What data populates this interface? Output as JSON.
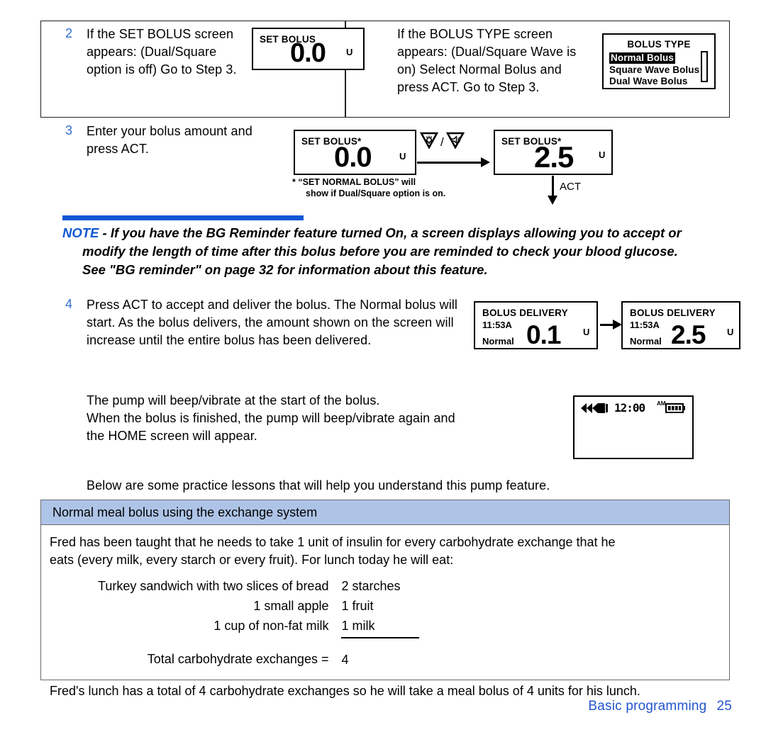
{
  "document": {
    "title": "Insulin pump user guide - Basic programming",
    "footer": {
      "section": "Basic programming",
      "page": "25"
    }
  },
  "colors": {
    "accent_blue": "#0f57d4",
    "footer_blue": "#2255cc",
    "lesson_header_bg": "#aec4e7",
    "step_number_blue": "#2f6fd0"
  },
  "steps": {
    "step2": {
      "number": "2",
      "text": "If the SET BOLUS screen appears: (Dual/Square option is off) Go to Step 3."
    },
    "step2b": {
      "text": "If the BOLUS TYPE screen appears: (Dual/Square Wave is on) Select Normal Bolus and press ACT. Go to Step 3."
    },
    "step3": {
      "number": "3",
      "text": "Enter your bolus amount and press ACT.",
      "footnote_line1": "* “SET NORMAL BOLUS” will",
      "footnote_line2": "show if Dual/Square option is on.",
      "act_label": "ACT"
    },
    "step4": {
      "number": "4",
      "text": "Press ACT to accept and deliver the bolus. The Normal bolus will start. As the bolus delivers, the amount shown on the screen will increase until the entire bolus has been delivered."
    }
  },
  "screens": {
    "set_bolus_1": {
      "title": "SET BOLUS",
      "value": "0.0",
      "unit": "U"
    },
    "bolus_type": {
      "title": "BOLUS TYPE",
      "options": [
        "Normal Bolus",
        "Square Wave Bolus",
        "Dual Wave Bolus"
      ],
      "selected": "Normal Bolus"
    },
    "set_bolus_star_1": {
      "title": "SET BOLUS*",
      "value": "0.0",
      "unit": "U"
    },
    "set_bolus_star_2": {
      "title": "SET BOLUS*",
      "value": "2.5",
      "unit": "U"
    },
    "bolus_delivery_1": {
      "title": "BOLUS DELIVERY",
      "time": "11:53A",
      "type": "Normal",
      "value": "0.1",
      "unit": "U"
    },
    "bolus_delivery_2": {
      "title": "BOLUS DELIVERY",
      "time": "11:53A",
      "type": "Normal",
      "value": "2.5",
      "unit": "U"
    },
    "home": {
      "time": "12:00",
      "meridiem": "AM"
    }
  },
  "note": {
    "label": "NOTE",
    "dash": " - ",
    "line1": "If you have the BG Reminder feature turned On, a screen displays allowing you to accept or",
    "line2": "modify the length of time after this bolus before you are reminded to check your blood glucose.",
    "line3": "See \"BG reminder\" on page 32 for information about this feature."
  },
  "paragraphs": {
    "beep_line1": "The pump will beep/vibrate at the start of the bolus.",
    "beep_line2": "When the bolus is finished, the pump will beep/vibrate again and",
    "beep_line3": "the HOME screen will appear.",
    "practice_intro": "Below are some practice lessons that will help you understand this pump feature."
  },
  "lesson": {
    "header": "Normal meal bolus using the exchange system",
    "intro_line1": "Fred has been taught that he needs to take 1 unit of insulin for every carbohydrate exchange that he",
    "intro_line2": "eats (every milk, every starch or every fruit). For lunch today he will eat:",
    "foods": [
      {
        "description": "Turkey sandwich with two slices of bread",
        "exchange": "2 starches"
      },
      {
        "description": "1 small apple",
        "exchange": "1 fruit"
      },
      {
        "description": "1 cup of non-fat milk",
        "exchange": "1 milk"
      }
    ],
    "total_label": "Total carbohydrate exchanges =",
    "total_value": "4",
    "closing": "Fred's lunch has a total of 4 carbohydrate exchanges so he will take a meal bolus of 4 units for his lunch."
  }
}
